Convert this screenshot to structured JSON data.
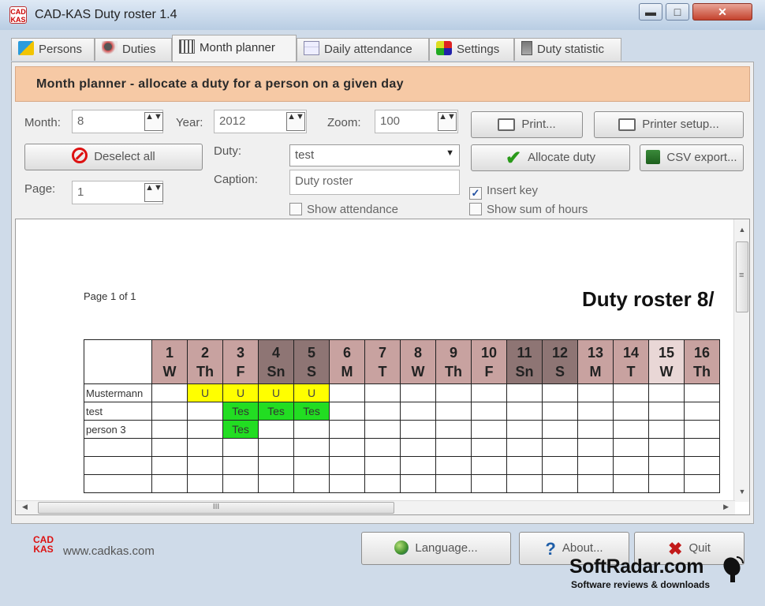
{
  "window": {
    "title": "CAD-KAS Duty roster 1.4",
    "minimize": "▬",
    "maximize": "□",
    "close": "✕"
  },
  "tabs": [
    {
      "label": "Persons",
      "icon": "person-icon"
    },
    {
      "label": "Duties",
      "icon": "duties-icon"
    },
    {
      "label": "Month planner",
      "icon": "calendar-icon",
      "active": true
    },
    {
      "label": "Daily attendance",
      "icon": "chart-icon"
    },
    {
      "label": "Settings",
      "icon": "settings-icon"
    },
    {
      "label": "Duty statistic",
      "icon": "statistic-icon"
    }
  ],
  "banner": "Month planner - allocate a duty for a person on a given day",
  "form": {
    "month_label": "Month:",
    "month_value": "8",
    "year_label": "Year:",
    "year_value": "2012",
    "zoom_label": "Zoom:",
    "zoom_value": "100",
    "page_label": "Page:",
    "page_value": "1",
    "duty_label": "Duty:",
    "duty_value": "test",
    "caption_label": "Caption:",
    "caption_value": "Duty roster",
    "show_attendance": "Show attendance",
    "show_attendance_checked": false,
    "insert_key": "Insert key",
    "insert_key_checked": true,
    "show_sum": "Show sum of hours",
    "show_sum_checked": false,
    "spin_glyph": "▲▼"
  },
  "buttons": {
    "deselect_all": "Deselect all",
    "print": "Print...",
    "printer_setup": "Printer setup...",
    "allocate_duty": "Allocate duty",
    "csv_export": "CSV export...",
    "language": "Language...",
    "about": "About...",
    "quit": "Quit"
  },
  "preview": {
    "page_of": "Page 1 of 1",
    "title": "Duty roster 8/",
    "days": [
      {
        "n": "1",
        "d": "W",
        "kind": "normal"
      },
      {
        "n": "2",
        "d": "Th",
        "kind": "normal"
      },
      {
        "n": "3",
        "d": "F",
        "kind": "normal"
      },
      {
        "n": "4",
        "d": "Sn",
        "kind": "weekend"
      },
      {
        "n": "5",
        "d": "S",
        "kind": "weekend"
      },
      {
        "n": "6",
        "d": "M",
        "kind": "normal"
      },
      {
        "n": "7",
        "d": "T",
        "kind": "normal"
      },
      {
        "n": "8",
        "d": "W",
        "kind": "normal"
      },
      {
        "n": "9",
        "d": "Th",
        "kind": "normal"
      },
      {
        "n": "10",
        "d": "F",
        "kind": "normal"
      },
      {
        "n": "11",
        "d": "Sn",
        "kind": "weekend"
      },
      {
        "n": "12",
        "d": "S",
        "kind": "weekend"
      },
      {
        "n": "13",
        "d": "M",
        "kind": "normal"
      },
      {
        "n": "14",
        "d": "T",
        "kind": "normal"
      },
      {
        "n": "15",
        "d": "W",
        "kind": "today"
      },
      {
        "n": "16",
        "d": "Th",
        "kind": "normal"
      }
    ],
    "rows": [
      {
        "name": "Mustermann",
        "cells": {
          "2": "U",
          "3": "U",
          "4": "U",
          "5": "U"
        },
        "kind": "u"
      },
      {
        "name": "test",
        "cells": {
          "3": "Tes",
          "4": "Tes",
          "5": "Tes"
        },
        "kind": "t"
      },
      {
        "name": "person 3",
        "cells": {
          "3": "Tes"
        },
        "kind": "t"
      },
      {
        "name": "",
        "cells": {}
      },
      {
        "name": "",
        "cells": {}
      },
      {
        "name": "",
        "cells": {}
      }
    ],
    "hscroll_grip": "III",
    "vscroll_grip": "≡"
  },
  "footer": {
    "logo_text": "CAD KAS",
    "site": "www.cadkas.com"
  },
  "watermark": {
    "main": "SoftRadar.com",
    "sub": "Software reviews & downloads"
  },
  "colors": {
    "banner": "#f6c9a5",
    "header_normal": "#c8a2a0",
    "header_weekend": "#8e7574",
    "header_today": "#e9d7d6",
    "duty_u": "#ffff00",
    "duty_test": "#22dd22"
  }
}
